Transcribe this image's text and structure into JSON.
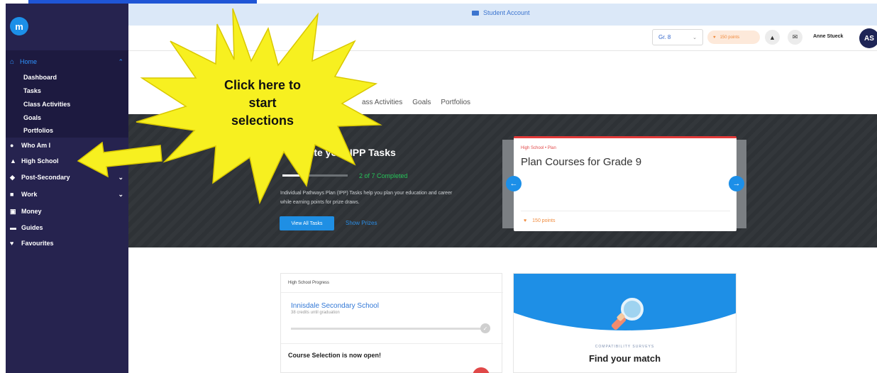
{
  "topbar": {
    "account_label": "Student Account",
    "grade": "Gr. 8",
    "points": "150 points",
    "user_name": "Anne Stueck",
    "avatar_initials": "AS"
  },
  "sidebar": {
    "logo": "m",
    "home": "Home",
    "sub_items": [
      "Dashboard",
      "Tasks",
      "Class Activities",
      "Goals",
      "Portfolios"
    ],
    "items": [
      {
        "label": "Who Am I",
        "icon": "circle-icon",
        "chevron": ""
      },
      {
        "label": "High School",
        "icon": "building-icon",
        "chevron": ""
      },
      {
        "label": "Post-Secondary",
        "icon": "graduation-cap-icon",
        "chevron": "⌄"
      },
      {
        "label": "Work",
        "icon": "briefcase-icon",
        "chevron": "⌄"
      },
      {
        "label": "Money",
        "icon": "money-icon",
        "chevron": ""
      },
      {
        "label": "Guides",
        "icon": "book-icon",
        "chevron": ""
      },
      {
        "label": "Favourites",
        "icon": "heart-icon",
        "chevron": ""
      }
    ]
  },
  "tabs": [
    "ass Activities",
    "Goals",
    "Portfolios"
  ],
  "hero": {
    "title": "e Sta te your IPP Tasks",
    "progress_text": "2 of 7 Completed",
    "progress_fraction": 0.2857,
    "description": "Individual Pathways Plan (IPP) Tasks help you plan your education and career while earning points for prize draws.",
    "view_button": "View All Tasks",
    "prizes_link": "Show Prizes"
  },
  "task_card": {
    "crumb": "High School • Plan",
    "title": "Plan Courses for Grade 9",
    "points": "150 points"
  },
  "progress_card": {
    "heading": "High School Progress",
    "school": "Innisdale Secondary School",
    "sub": "38 credits until graduation",
    "course_open": "Course Selection is now open!"
  },
  "match_card": {
    "kicker": "COMPATIBILITY SURVEYS",
    "title": "Find your match"
  },
  "callout": {
    "line1": "Click here to",
    "line2": "start",
    "line3": "selections"
  },
  "colors": {
    "sidebar": "#26234f",
    "accent": "#1c8fe8",
    "burst": "#f7f020",
    "arrow": "#f7f020"
  }
}
